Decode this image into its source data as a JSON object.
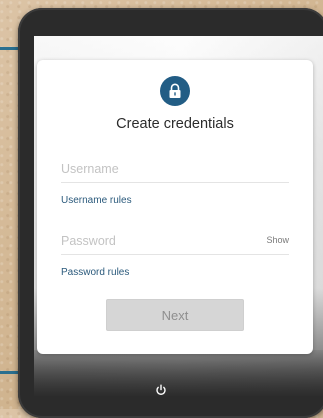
{
  "card": {
    "title": "Create credentials",
    "username": {
      "value": "",
      "placeholder": "Username",
      "rules_label": "Username rules"
    },
    "password": {
      "value": "",
      "placeholder": "Password",
      "show_label": "Show",
      "rules_label": "Password rules"
    },
    "next_label": "Next"
  },
  "icons": {
    "lock": "lock-icon",
    "power": "power-icon"
  },
  "colors": {
    "accent": "#225d85",
    "link": "#2b5a7c",
    "button_disabled": "#d6d6d6",
    "device": "#2b2b2b",
    "background": "#d4b996"
  }
}
